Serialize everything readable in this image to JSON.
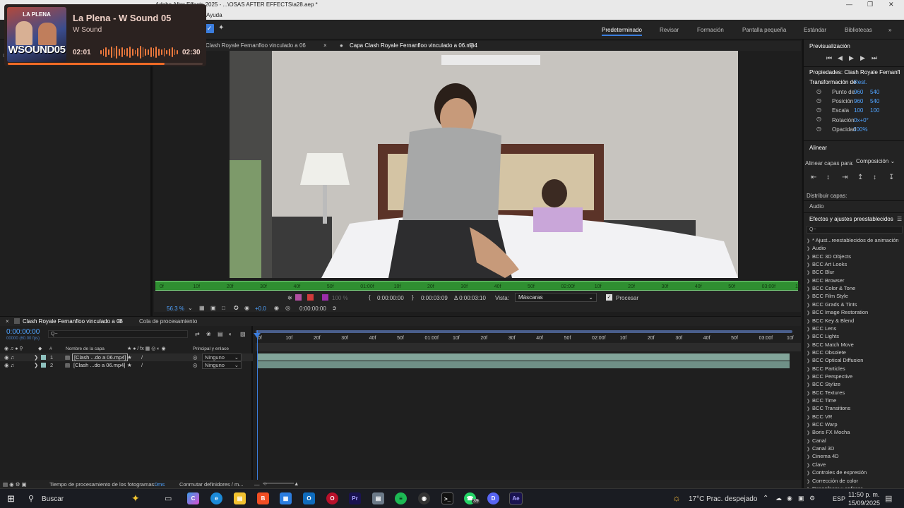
{
  "window": {
    "title": "Adobe After Effects 2025 - ...\\OSAS AFTER EFFECTS\\a28.aep *",
    "menu_help": "Ayuda"
  },
  "workspaces": [
    "Predeterminado",
    "Revisar",
    "Formación",
    "Pantalla pequeña",
    "Estándar",
    "Bibliotecas"
  ],
  "music_overlay": {
    "song": "La Plena - W Sound 05",
    "artist": "W Sound",
    "elapsed": "02:01",
    "total": "02:30",
    "progress_fraction": 0.806,
    "art_top": "LA PLENA",
    "art_bottom": "WSOUND05",
    "accent": "#f06a26"
  },
  "left_panel": {
    "label": "Cl"
  },
  "viewer": {
    "tab_left": "Clash Royale Fernanfloo vinculado a 06",
    "tab_right": "Capa Clash Royale Fernanfloo vinculado a 06.mp4",
    "ruler_ticks": [
      "0f",
      "10f",
      "20f",
      "30f",
      "40f",
      "50f",
      "01:00f",
      "10f",
      "20f",
      "30f",
      "40f",
      "50f",
      "02:00f",
      "10f",
      "20f",
      "30f",
      "40f",
      "50f",
      "03:00f",
      "10"
    ],
    "zoom": "56.3 %",
    "pct": "100 %",
    "offset": "+0.0",
    "timecode": "0:00:00:00",
    "in_point": "0:00:00:00",
    "out_point": "0:00:03:09",
    "duration": "Δ 0:00:03:10",
    "view_label": "Vista:",
    "view_value": "Máscaras",
    "process_label": "Procesar"
  },
  "right_panel": {
    "preview_title": "Previsualización",
    "props_title": "Propiedades: Clash Royale Fernanfl",
    "transform_label": "Transformación de",
    "transform_reset": "Rest.",
    "props": [
      {
        "label": "Punto de",
        "v1": "960",
        "v2": "540"
      },
      {
        "label": "Posición",
        "v1": "960",
        "v2": "540"
      },
      {
        "label": "Escala",
        "v1": "100",
        "v2": "100"
      },
      {
        "label": "Rotación",
        "v1": "0x+0°",
        "v2": ""
      },
      {
        "label": "Opacidad",
        "v1": "100%",
        "v2": ""
      }
    ],
    "align_title": "Alinear",
    "align_to_label": "Alinear capas para:",
    "align_to_value": "Composición",
    "distribute_label": "Distribuir capas:",
    "audio_label": "Audio",
    "effects_title": "Efectos y ajustes preestablecidos",
    "search_placeholder": "Q~",
    "effects": [
      "* Ajust...reestablecidos de animación",
      "Audio",
      "BCC 3D Objects",
      "BCC Art Looks",
      "BCC Blur",
      "BCC Browser",
      "BCC Color & Tone",
      "BCC Film Style",
      "BCC Grads & Tints",
      "BCC Image Restoration",
      "BCC Key & Blend",
      "BCC Lens",
      "BCC Lights",
      "BCC Match Move",
      "BCC Obsolete",
      "BCC Optical Diffusion",
      "BCC Particles",
      "BCC Perspective",
      "BCC Stylize",
      "BCC Textures",
      "BCC Time",
      "BCC Transitions",
      "BCC VR",
      "BCC Warp",
      "Boris FX Mocha",
      "Canal",
      "Canal 3D",
      "Cinema 4D",
      "Clave",
      "Controles de expresión",
      "Corrección de color",
      "Desenfocar y enfocar"
    ]
  },
  "timeline": {
    "tab_comp": "Clash Royale Fernanfloo vinculado a 06",
    "tab_queue": "Cola de procesamiento",
    "timecode": "0:00:00:00",
    "fps": "00000 (60.00 fps)",
    "search_placeholder": "Q~",
    "col_hash": "#",
    "col_name": "Nombre de la capa",
    "col_parent": "Principal y enlace",
    "ruler": [
      "0f",
      "10f",
      "20f",
      "30f",
      "40f",
      "50f",
      "01:00f",
      "10f",
      "20f",
      "30f",
      "40f",
      "50f",
      "02:00f",
      "10f",
      "20f",
      "30f",
      "40f",
      "50f",
      "03:00f",
      "10f"
    ],
    "layers": [
      {
        "num": "1",
        "name": "[Clash ...do a 06.mp4]",
        "parent": "Ninguno"
      },
      {
        "num": "2",
        "name": "[Clash ...do a 06.mp4]",
        "parent": "Ninguno"
      }
    ],
    "status_label": "Tiempo de procesamiento de los fotogramas:",
    "status_value": "0ms",
    "toggle_label": "Conmutar definidores / m..."
  },
  "taskbar": {
    "search": "Buscar",
    "weather": "17°C  Prac. despejado",
    "lang": "ESP",
    "time": "11:50 p. m.",
    "date": "15/09/2025",
    "whatsapp_badge": "39"
  }
}
